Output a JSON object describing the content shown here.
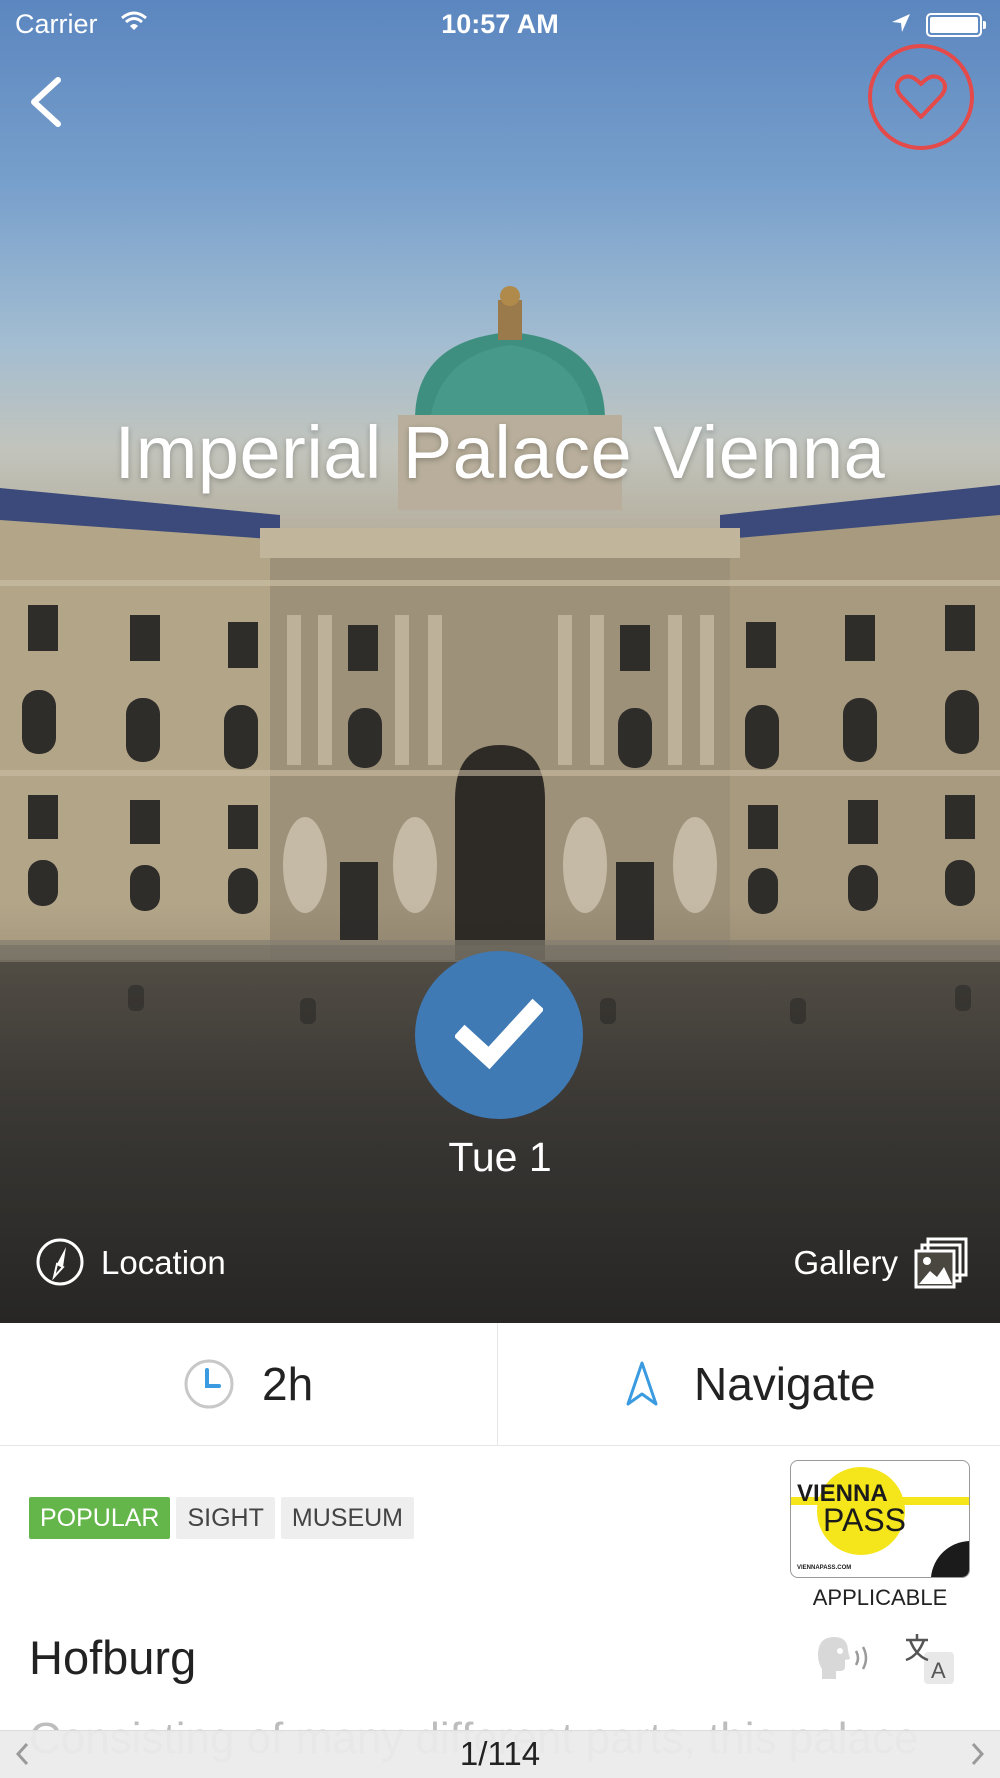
{
  "status_bar": {
    "carrier": "Carrier",
    "time": "10:57 AM"
  },
  "hero": {
    "title": "Imperial Palace Vienna",
    "visited_day": "Tue 1",
    "location_label": "Location",
    "gallery_label": "Gallery"
  },
  "info": {
    "duration": "2h",
    "navigate_label": "Navigate"
  },
  "tags": [
    "POPULAR",
    "SIGHT",
    "MUSEUM"
  ],
  "pass": {
    "brand_top": "VIENNA",
    "brand_bottom": "PASS",
    "url": "VIENNAPASS.COM",
    "applicable": "APPLICABLE"
  },
  "place": {
    "name": "Hofburg",
    "description_start": "Consisting of many different parts, this palace"
  },
  "pager": {
    "position": "1/114"
  },
  "colors": {
    "accent_blue": "#3f7ab5",
    "favorite_red": "#e44a4a",
    "popular_green": "#65b64a"
  },
  "icons": {
    "back": "chevron-left-icon",
    "favorite": "heart-icon",
    "check": "checkmark-icon",
    "location": "compass-icon",
    "gallery": "gallery-icon",
    "duration": "clock-icon",
    "navigate": "navigation-arrow-icon",
    "audio": "speaker-head-icon",
    "translate": "translate-icon"
  }
}
